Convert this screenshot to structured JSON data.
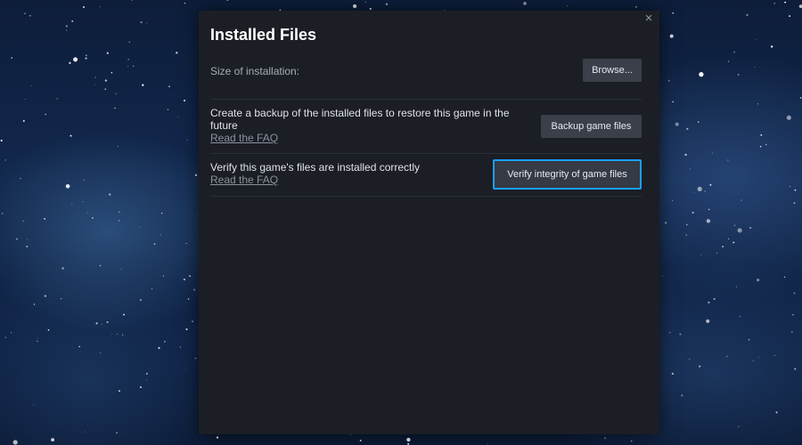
{
  "dialog": {
    "title": "Installed Files",
    "close_glyph": "×"
  },
  "rows": {
    "size": {
      "label": "Size of installation:",
      "button": "Browse..."
    },
    "backup": {
      "description": "Create a backup of the installed files to restore this game in the future",
      "link": "Read the FAQ",
      "button": "Backup game files"
    },
    "verify": {
      "description": "Verify this game's files are installed correctly",
      "link": "Read the FAQ",
      "button": "Verify integrity of game files"
    }
  },
  "colors": {
    "dialog_bg": "#1b1e25",
    "button_bg": "#3a3f49",
    "focus_ring": "#1a9fff"
  },
  "icons": {
    "close": "close-icon"
  }
}
